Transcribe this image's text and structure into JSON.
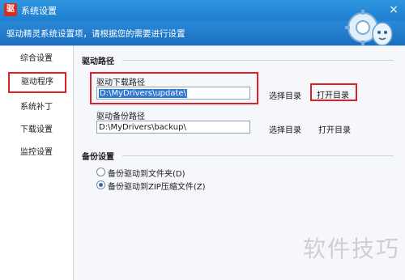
{
  "window": {
    "title": "系统设置",
    "close_glyph": "×"
  },
  "header": {
    "text": "驱动精灵系统设置项，请根据您的需要进行设置"
  },
  "sidebar": {
    "items": [
      "综合设置",
      "驱动程序",
      "系统补丁",
      "下载设置",
      "监控设置"
    ],
    "active_index": 1
  },
  "driver_path": {
    "title": "驱动路径",
    "download_label": "驱动下载路径",
    "download_value": "D:\\MyDrivers\\update\\",
    "backup_label": "驱动备份路径",
    "backup_value": "D:\\MyDrivers\\backup\\",
    "choose_label": "选择目录",
    "open_label": "打开目录"
  },
  "backup": {
    "title": "备份设置",
    "options": [
      "备份驱动到文件夹(D)",
      "备份驱动到ZIP压缩文件(Z)"
    ],
    "selected_index": 1
  },
  "watermark": "软件技巧",
  "colors": {
    "accent": "#1f7fd0",
    "highlight_border": "#e01f26",
    "selection": "#2f78d4"
  }
}
